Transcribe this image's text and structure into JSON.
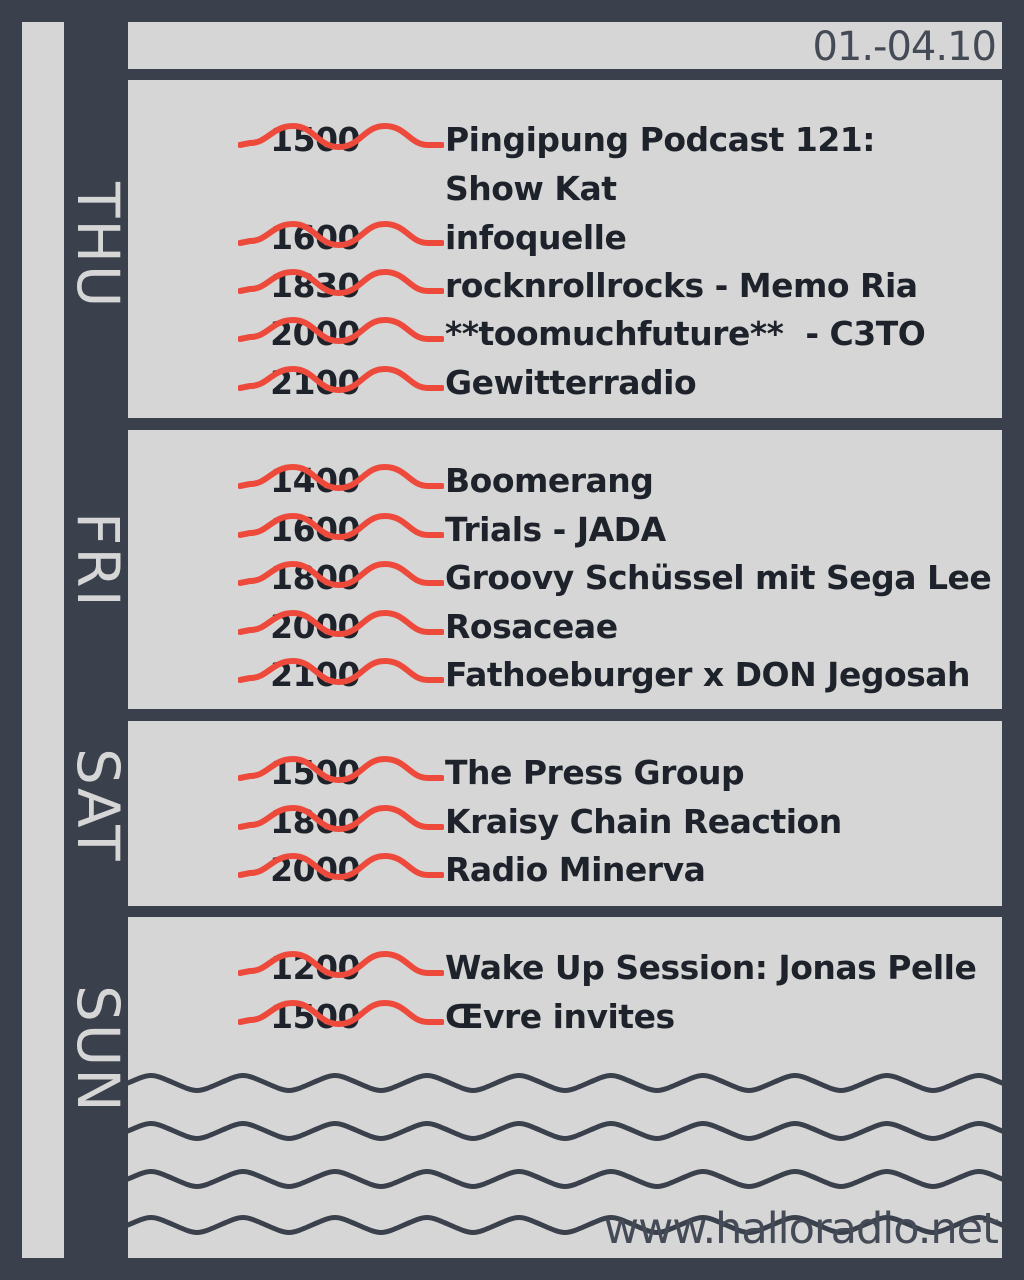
{
  "header": {
    "date_range": "01.-04.10"
  },
  "days": [
    {
      "label": "THU",
      "shows": [
        {
          "time": "1500",
          "title": "Pingipung Podcast 121:"
        },
        {
          "time": "",
          "title": "Show Kat"
        },
        {
          "time": "1600",
          "title": "infoquelle"
        },
        {
          "time": "1830",
          "title": "rocknrollrocks - Memo Ria"
        },
        {
          "time": "2000",
          "title": "**toomuchfuture**  - C3TO"
        },
        {
          "time": "2100",
          "title": "Gewitterradio"
        }
      ]
    },
    {
      "label": "FRI",
      "shows": [
        {
          "time": "1400",
          "title": "Boomerang"
        },
        {
          "time": "1600",
          "title": "Trials - JADA"
        },
        {
          "time": "1800",
          "title": "Groovy Schüssel mit Sega Lee"
        },
        {
          "time": "2000",
          "title": "Rosaceae"
        },
        {
          "time": "2100",
          "title": "Fathoeburger x DON Jegosah"
        }
      ]
    },
    {
      "label": "SAT",
      "shows": [
        {
          "time": "1500",
          "title": "The Press Group"
        },
        {
          "time": "1800",
          "title": "Kraisy Chain Reaction"
        },
        {
          "time": "2000",
          "title": "Radio Minerva"
        }
      ]
    },
    {
      "label": "SUN",
      "shows": [
        {
          "time": "1200",
          "title": "Wake Up Session: Jonas Pelle"
        },
        {
          "time": "1500",
          "title": "Œvre invites"
        }
      ]
    }
  ],
  "footer": {
    "url": "www.halloradio.net"
  },
  "colors": {
    "background": "#3a414c",
    "panel": "#d6d6d6",
    "accent_wave": "#ee4a3c",
    "text": "#1e232b"
  },
  "icons": {
    "show_marker": "red-wave-icon",
    "decoration": "dark-wave-pattern"
  }
}
